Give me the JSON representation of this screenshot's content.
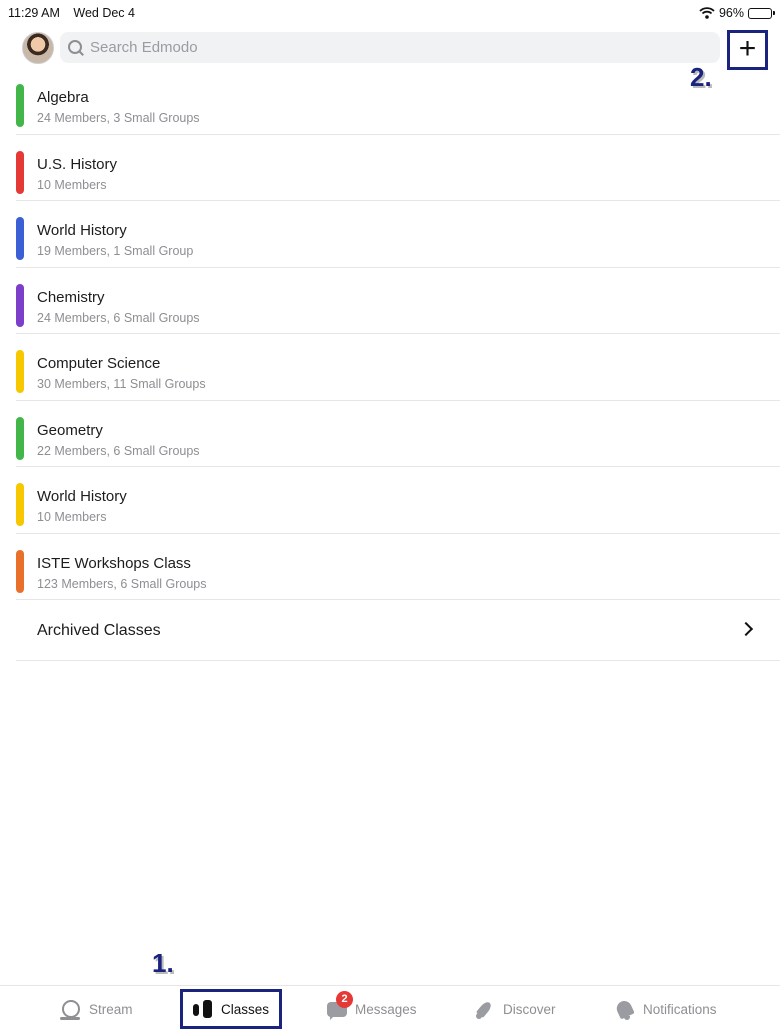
{
  "status_bar": {
    "time": "11:29 AM",
    "date": "Wed Dec 4",
    "battery": "96%",
    "battery_level": 0.96
  },
  "header": {
    "search_placeholder": "Search Edmodo",
    "add_icon": "plus-icon"
  },
  "annotations": {
    "step1": "1.",
    "step2": "2."
  },
  "classes": [
    {
      "name": "Algebra",
      "meta": "24 Members, 3 Small Groups",
      "color": "#43b649"
    },
    {
      "name": "U.S. History",
      "meta": "10 Members",
      "color": "#e53935"
    },
    {
      "name": "World History",
      "meta": "19 Members, 1 Small Group",
      "color": "#3b5fd4"
    },
    {
      "name": "Chemistry",
      "meta": "24 Members, 6 Small Groups",
      "color": "#7b3fc9"
    },
    {
      "name": "Computer Science",
      "meta": "30 Members, 11 Small Groups",
      "color": "#f7c800"
    },
    {
      "name": "Geometry",
      "meta": "22 Members, 6 Small Groups",
      "color": "#43b649"
    },
    {
      "name": "World History",
      "meta": "10 Members",
      "color": "#f7c800"
    },
    {
      "name": "ISTE Workshops Class",
      "meta": "123 Members, 6 Small Groups",
      "color": "#e8702a"
    }
  ],
  "archived": {
    "label": "Archived Classes"
  },
  "tabs": {
    "stream": "Stream",
    "classes": "Classes",
    "messages": "Messages",
    "messages_badge": "2",
    "discover": "Discover",
    "notifications": "Notifications"
  }
}
